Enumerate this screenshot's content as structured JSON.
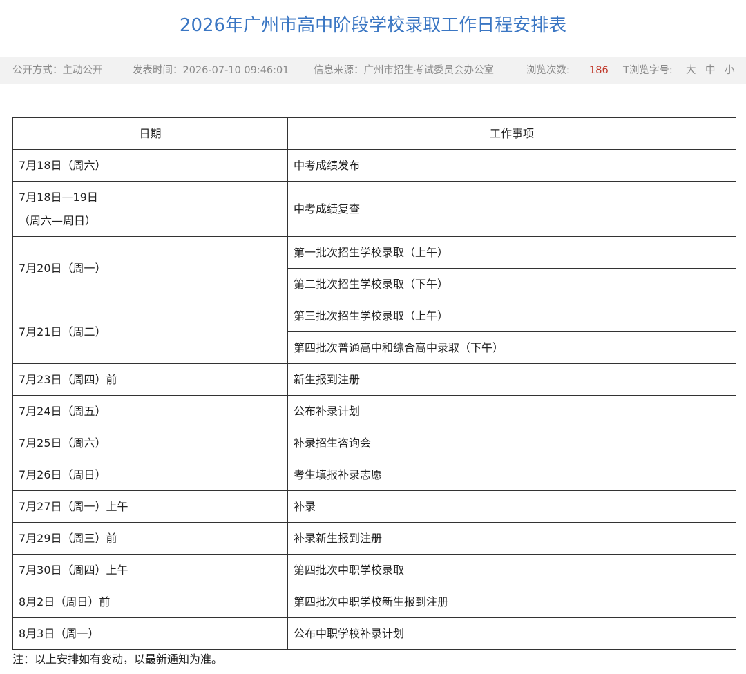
{
  "page": {
    "title": "2026年广州市高中阶段学校录取工作日程安排表"
  },
  "meta": {
    "disclosure": "公开方式：主动公开",
    "publish_time": "发表时间：2026-07-10 09:46:01",
    "source": "信息来源：广州市招生考试委员会办公室",
    "views_label": "浏览次数:",
    "views_count": "186",
    "font_size_label": "T浏览字号:",
    "size_large": "大",
    "size_medium": "中",
    "size_small": "小"
  },
  "table": {
    "headers": {
      "date": "日期",
      "task": "工作事项"
    },
    "rows": [
      {
        "date": "7月18日（周六）",
        "tasks": [
          "中考成绩发布"
        ]
      },
      {
        "date_lines": [
          "7月18日—19日",
          "（周六—周日）"
        ],
        "tasks": [
          "中考成绩复查"
        ]
      },
      {
        "date": "7月20日（周一）",
        "tasks": [
          "第一批次招生学校录取（上午）",
          "第二批次招生学校录取（下午）"
        ]
      },
      {
        "date": "7月21日（周二）",
        "tasks": [
          "第三批次招生学校录取（上午）",
          "第四批次普通高中和综合高中录取（下午）"
        ]
      },
      {
        "date": "7月23日（周四）前",
        "tasks": [
          "新生报到注册"
        ]
      },
      {
        "date": "7月24日（周五）",
        "tasks": [
          "公布补录计划"
        ]
      },
      {
        "date": "7月25日（周六）",
        "tasks": [
          "补录招生咨询会"
        ]
      },
      {
        "date": "7月26日（周日）",
        "tasks": [
          "考生填报补录志愿"
        ]
      },
      {
        "date": "7月27日（周一）上午",
        "tasks": [
          "补录"
        ]
      },
      {
        "date": "7月29日（周三）前",
        "tasks": [
          "补录新生报到注册"
        ]
      },
      {
        "date": "7月30日（周四）上午",
        "tasks": [
          "第四批次中职学校录取"
        ]
      },
      {
        "date": "8月2日（周日）前",
        "tasks": [
          "第四批次中职学校新生报到注册"
        ]
      },
      {
        "date": "8月3日（周一）",
        "tasks": [
          "公布中职学校补录计划"
        ]
      }
    ]
  },
  "footnote": "注：以上安排如有变动，以最新通知为准。"
}
